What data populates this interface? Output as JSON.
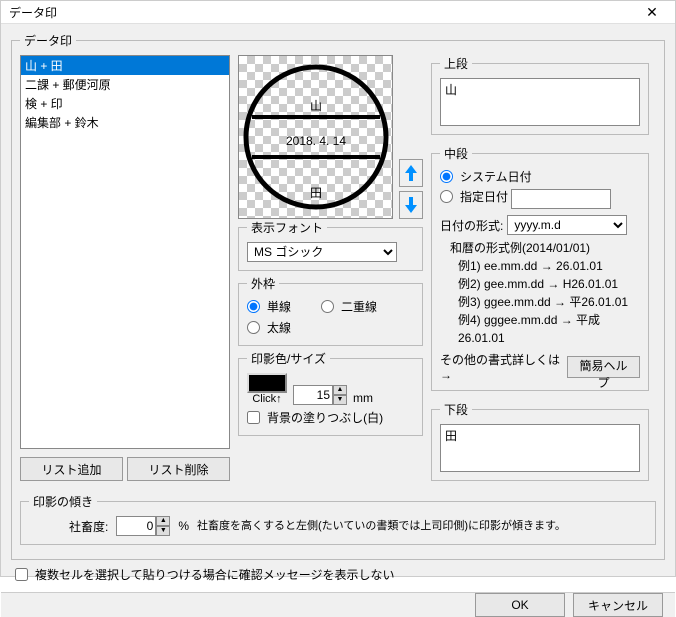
{
  "title": "データ印",
  "group_label": "データ印",
  "list": {
    "items": [
      "山 + 田",
      "二課 + 郵便河原",
      "検 + 印",
      "編集部 + 鈴木"
    ],
    "selected": 0
  },
  "list_buttons": {
    "add": "リスト追加",
    "delete": "リスト削除"
  },
  "stamp": {
    "top": "山",
    "date": "2018. 4. 14",
    "bottom": "田"
  },
  "font": {
    "legend": "表示フォント",
    "value": "MS ゴシック"
  },
  "frame": {
    "legend": "外枠",
    "single": "単線",
    "double": "二重線",
    "bold": "太線",
    "selected": "single"
  },
  "color_size": {
    "legend": "印影色/サイズ",
    "click_label": "Click↑",
    "size": 15,
    "unit": "mm",
    "fill_bg": "背景の塗りつぶし(白)"
  },
  "upper": {
    "legend": "上段",
    "value": "山"
  },
  "middle": {
    "legend": "中段",
    "sys_date": "システム日付",
    "fixed_date": "指定日付",
    "selected": "sys",
    "fixed_value": "",
    "fmt_label": "日付の形式:",
    "fmt_value": "yyyy.m.d",
    "ex_title": "和暦の形式例(2014/01/01)",
    "ex1": "例1) ee.mm.dd → 26.01.01",
    "ex2": "例2) gee.mm.dd → H26.01.01",
    "ex3": "例3) ggee.mm.dd → 平26.01.01",
    "ex4": "例4) gggee.mm.dd → 平成26.01.01",
    "help_label": "その他の書式詳しくは→",
    "help_btn": "簡易ヘルプ"
  },
  "lower": {
    "legend": "下段",
    "value": "田"
  },
  "tilt": {
    "legend": "印影の傾き",
    "label": "社畜度:",
    "value": 0,
    "unit": "%",
    "desc": "社畜度を高くすると左側(たいていの書類では上司印側)に印影が傾きます。"
  },
  "confirm_check": "複数セルを選択して貼りつける場合に確認メッセージを表示しない",
  "buttons": {
    "ok": "OK",
    "cancel": "キャンセル"
  }
}
